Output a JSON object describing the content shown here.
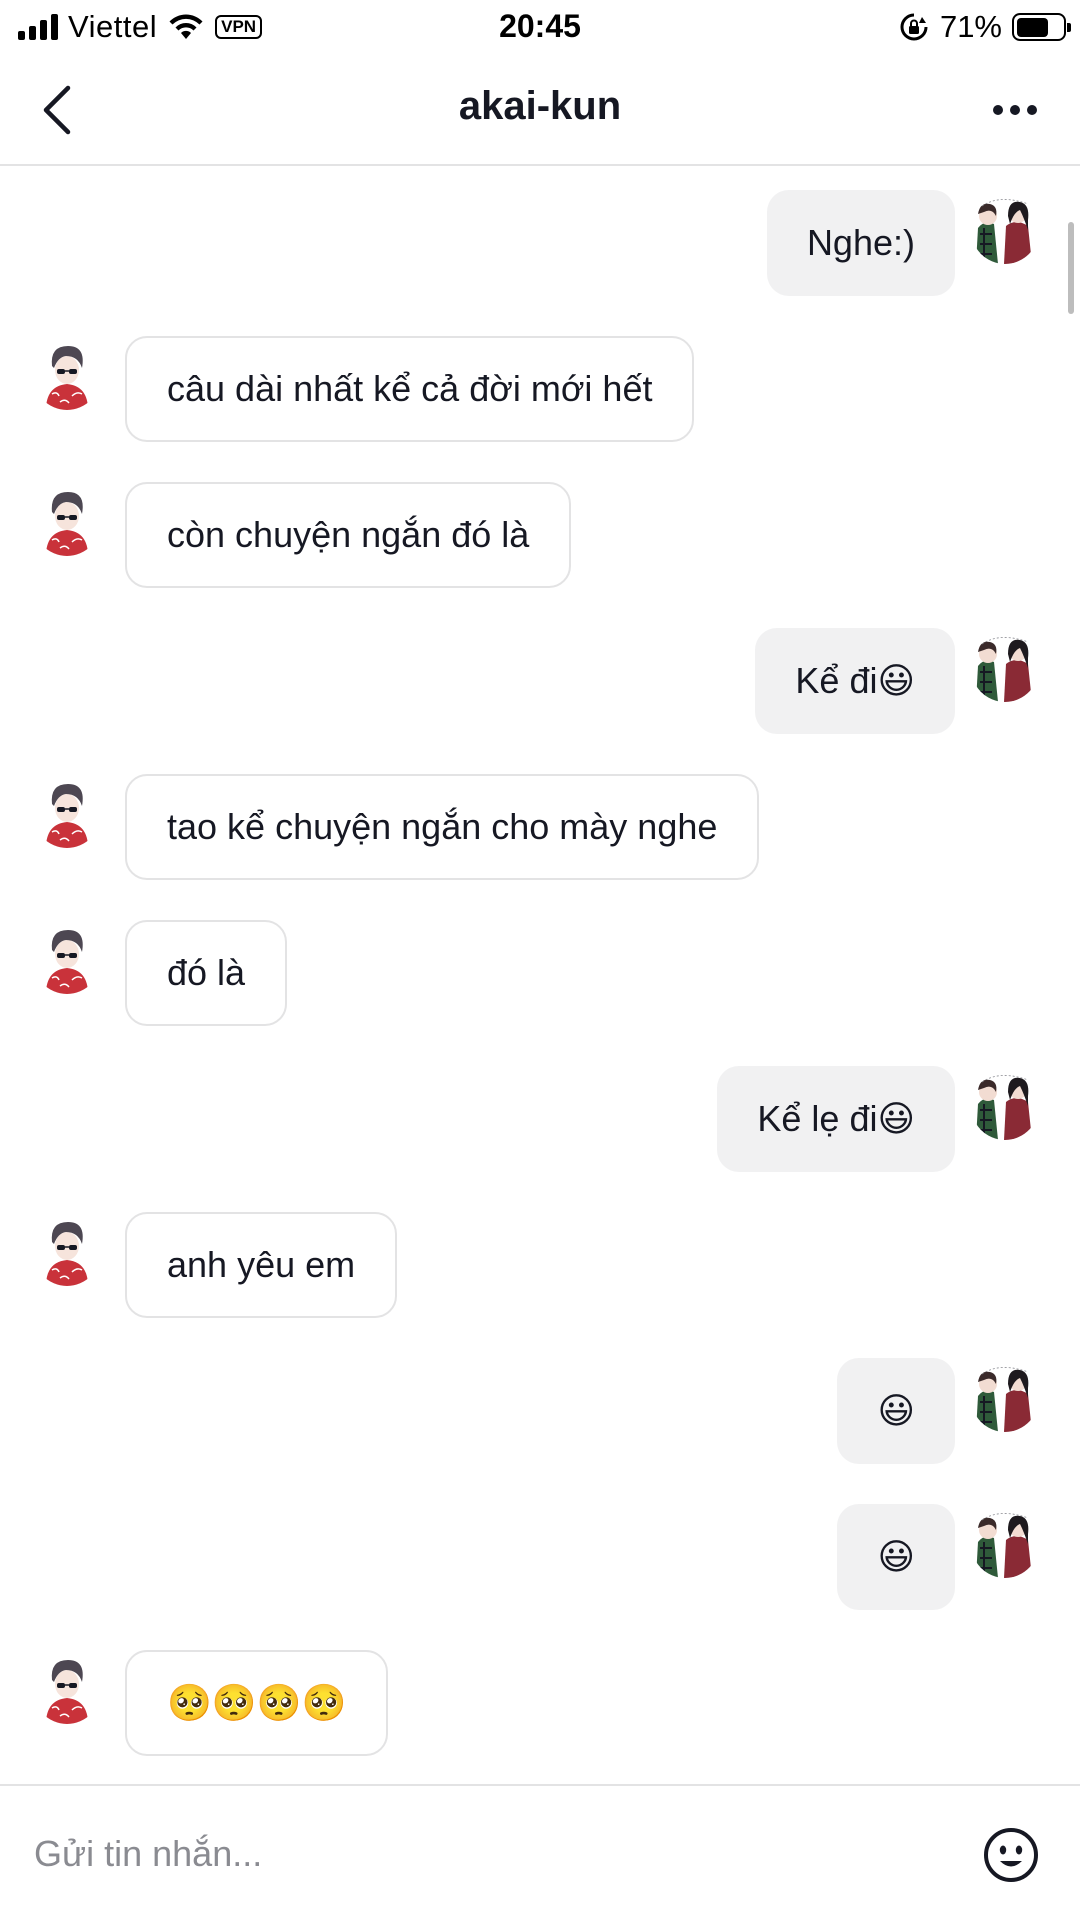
{
  "status_bar": {
    "carrier": "Viettel",
    "vpn": "VPN",
    "time": "20:45",
    "battery_percent": "71%",
    "battery_level": 0.71
  },
  "header": {
    "title": "akai-kun"
  },
  "messages": [
    {
      "side": "sent",
      "text": "Nghe:)"
    },
    {
      "side": "recv",
      "text": "câu dài nhất kể cả đời mới hết"
    },
    {
      "side": "recv",
      "text": "còn chuyện ngắn đó là"
    },
    {
      "side": "sent",
      "text": "Kể đi😃"
    },
    {
      "side": "recv",
      "text": "tao kể chuyện ngắn cho mày nghe"
    },
    {
      "side": "recv",
      "text": "đó là"
    },
    {
      "side": "sent",
      "text": "Kể lẹ đi😃"
    },
    {
      "side": "recv",
      "text": "anh yêu em"
    },
    {
      "side": "sent",
      "text": "😃"
    },
    {
      "side": "sent",
      "text": "😃"
    },
    {
      "side": "recv",
      "text": "🥺🥺🥺🥺"
    }
  ],
  "composer": {
    "placeholder": "Gửi tin nhắn..."
  },
  "colors": {
    "sent_bubble": "#f1f1f2",
    "recv_border": "#e3e3e4",
    "text": "#161823",
    "placeholder": "#8a8b91"
  }
}
